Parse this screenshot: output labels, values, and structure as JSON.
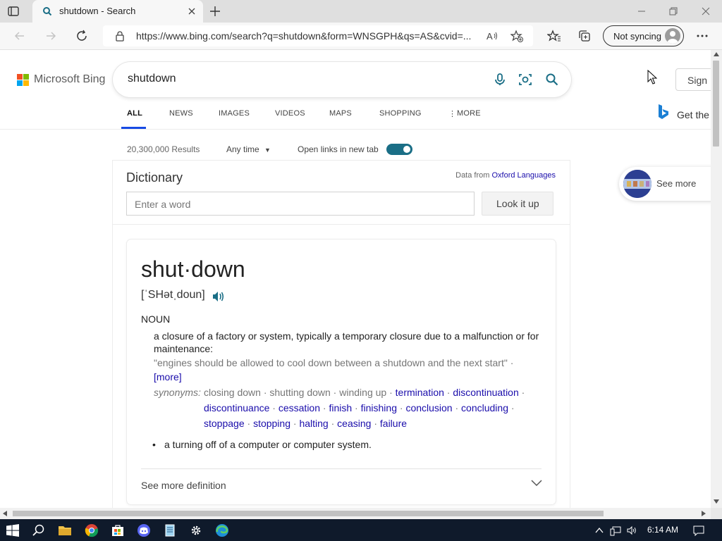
{
  "browser": {
    "tab_title": "shutdown - Search",
    "url": "https://www.bing.com/search?q=shutdown&form=WNSGPH&qs=AS&cvid=...",
    "sync_label": "Not syncing"
  },
  "header": {
    "logo_text": "Microsoft Bing",
    "query": "shutdown",
    "signin_label": "Sign",
    "copilot_label": "Get the"
  },
  "scopes": [
    {
      "label": "ALL"
    },
    {
      "label": "NEWS"
    },
    {
      "label": "IMAGES"
    },
    {
      "label": "VIDEOS"
    },
    {
      "label": "MAPS"
    },
    {
      "label": "SHOPPING"
    },
    {
      "label": "MORE"
    }
  ],
  "filters": {
    "results_count": "20,300,000 Results",
    "time_filter": "Any time",
    "open_new_tab_label": "Open links in new tab",
    "open_new_tab_on": true
  },
  "dictionary": {
    "title": "Dictionary",
    "source_prefix": "Data from",
    "source_name": "Oxford Languages",
    "input_placeholder": "Enter a word",
    "lookup_label": "Look it up",
    "headword": "shut·down",
    "pronunciation": "[ˈSHətˌdoun]",
    "part_of_speech": "NOUN",
    "definition_1": "a closure of a factory or system, typically a temporary closure due to a malfunction or for maintenance:",
    "example": "\"engines should be allowed to cool down between a shutdown and the next start\" ·",
    "more_label": "[more]",
    "synonyms_label": "synonyms:",
    "synonym_lines": [
      [
        {
          "text": "closing down",
          "link": false
        },
        {
          "text": "shutting down",
          "link": false
        },
        {
          "text": "winding up",
          "link": false
        },
        {
          "text": "termination",
          "link": true
        },
        {
          "text": "discontinuation",
          "link": true
        }
      ],
      [
        {
          "text": "discontinuance",
          "link": true
        },
        {
          "text": "cessation",
          "link": true
        },
        {
          "text": "finish",
          "link": true
        },
        {
          "text": "finishing",
          "link": true
        },
        {
          "text": "conclusion",
          "link": true
        },
        {
          "text": "concluding",
          "link": true
        }
      ],
      [
        {
          "text": "stoppage",
          "link": true
        },
        {
          "text": "stopping",
          "link": true
        },
        {
          "text": "halting",
          "link": true
        },
        {
          "text": "ceasing",
          "link": true
        },
        {
          "text": "failure",
          "link": true
        }
      ]
    ],
    "definition_2": "a turning off of a computer or computer system.",
    "see_more_label": "See more definition"
  },
  "side": {
    "see_more_label": "See more"
  },
  "taskbar": {
    "time": "6:14 AM"
  },
  "colors": {
    "accent": "#1a6e86",
    "link": "#1a0dab",
    "scope_underline": "#174ae4",
    "taskbar": "#0f1a2b"
  }
}
